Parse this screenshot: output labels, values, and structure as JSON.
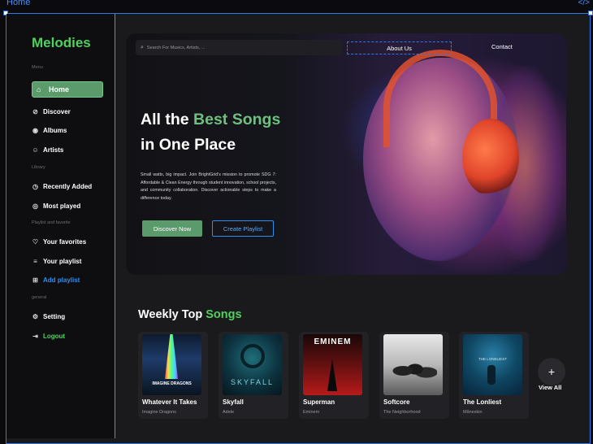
{
  "frame": {
    "label": "Home",
    "code_icon": "code-icon"
  },
  "sidebar": {
    "brand": "Melodies",
    "sections": {
      "menu": "Menu",
      "library": "Library",
      "playlist": "Playlist and favorite",
      "general": "general"
    },
    "items": [
      {
        "label": "Home",
        "icon": "home-icon"
      },
      {
        "label": "Discover",
        "icon": "compass-icon"
      },
      {
        "label": "Albums",
        "icon": "disc-icon"
      },
      {
        "label": "Artists",
        "icon": "user-icon"
      },
      {
        "label": "Recently Added",
        "icon": "clock-icon"
      },
      {
        "label": "Most played",
        "icon": "target-icon"
      },
      {
        "label": "Your favorites",
        "icon": "heart-icon"
      },
      {
        "label": "Your playlist",
        "icon": "playlist-icon"
      },
      {
        "label": "Add playlist",
        "icon": "add-playlist-icon"
      },
      {
        "label": "Setting",
        "icon": "gear-icon"
      },
      {
        "label": "Logout",
        "icon": "logout-icon"
      }
    ]
  },
  "header": {
    "search_placeholder": "Search For Musics, Artists, ...",
    "about": "About Us",
    "contact": "Contact"
  },
  "hero": {
    "line1_a": "All the ",
    "line1_b": "Best Songs",
    "line2": "in One Place",
    "description": "Small watts, big impact. Join BrightGrid's mission to promote SDG 7: Affordable & Clean Energy through student innovation, school projects, and community collaboration. Discover actionable steps to make a difference today.",
    "discover_btn": "Discover Now",
    "create_btn": "Create Playlist"
  },
  "weekly": {
    "title_a": "Weekly Top ",
    "title_b": "Songs",
    "songs": [
      {
        "title": "Whatever It Takes",
        "artist": "Imagine Dragons",
        "art_text": "IMAGINE DRAGONS"
      },
      {
        "title": "Skyfall",
        "artist": "Adele",
        "art_text": "SKYFALL"
      },
      {
        "title": "Superman",
        "artist": "Eminem",
        "art_text": "EMINEM"
      },
      {
        "title": "Softcore",
        "artist": "The Neighborhood",
        "art_text": ""
      },
      {
        "title": "The Lonliest",
        "artist": "Måneskin",
        "art_text": "THE LONELIEST"
      }
    ],
    "view_all": "View All"
  },
  "colors": {
    "accent_green": "#4fd15d",
    "button_green": "#5a9a6b",
    "accent_blue": "#2d8ef0",
    "pink_divider": "#d25aa8"
  }
}
